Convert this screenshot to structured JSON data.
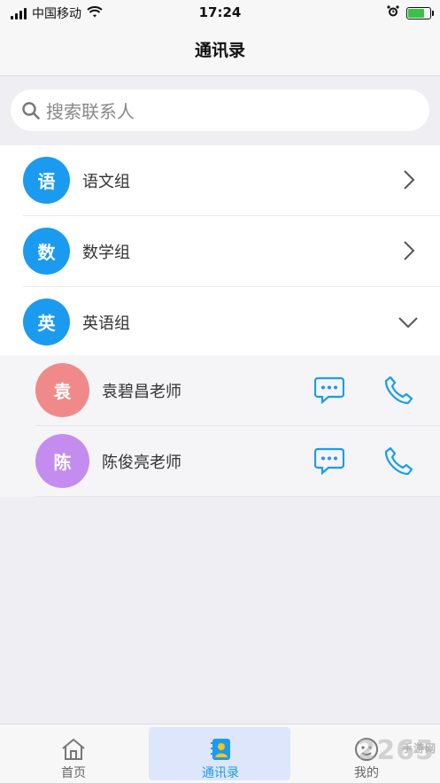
{
  "status_bar": {
    "carrier": "中国移动",
    "time": "17:24",
    "battery_level": 0.8,
    "battery_color": "#3bc14a"
  },
  "header": {
    "title": "通讯录"
  },
  "search": {
    "placeholder": "搜索联系人"
  },
  "groups": [
    {
      "avatar_char": "语",
      "label": "语文组",
      "expanded": false
    },
    {
      "avatar_char": "数",
      "label": "数学组",
      "expanded": false
    },
    {
      "avatar_char": "英",
      "label": "英语组",
      "expanded": true
    }
  ],
  "members": [
    {
      "avatar_char": "袁",
      "name": "袁碧昌老师",
      "avatar_color": "#f08a8a"
    },
    {
      "avatar_char": "陈",
      "name": "陈俊亮老师",
      "avatar_color": "#c58cf0"
    }
  ],
  "tabbar": {
    "tabs": [
      {
        "label": "首页",
        "icon": "home-icon"
      },
      {
        "label": "通讯录",
        "icon": "contacts-icon",
        "active": true
      },
      {
        "label": "我的",
        "icon": "profile-icon"
      }
    ]
  },
  "watermark": {
    "text": "2265",
    "sub": "手游网"
  },
  "colors": {
    "accent": "#1a9bf0",
    "group_avatar": "#1a9bf0"
  }
}
